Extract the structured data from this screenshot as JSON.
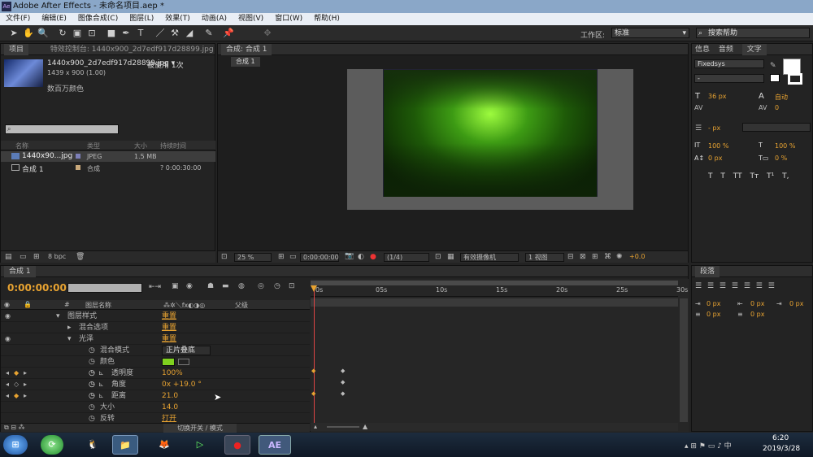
{
  "window": {
    "title": "Adobe After Effects - 未命名项目.aep *",
    "logo": "Ae"
  },
  "menu": [
    "文件(F)",
    "编辑(E)",
    "图像合成(C)",
    "图层(L)",
    "效果(T)",
    "动画(A)",
    "视图(V)",
    "窗口(W)",
    "帮助(H)"
  ],
  "toolbar": {
    "workspace_label": "工作区:",
    "workspace_value": "标准",
    "search_placeholder": "搜索帮助"
  },
  "project": {
    "tab_project": "项目",
    "tab_effects": "特效控制台: 1440x900_2d7edf917d28899.jpg",
    "file_name": "1440x900_2d7edf917d28899.jpg ▾",
    "used": "被使用 1次",
    "dims": "1439 x 900 (1.00)",
    "color": "数百万颜色",
    "columns": [
      "名称",
      "类型",
      "大小",
      "持续时间"
    ],
    "items": [
      {
        "name": "1440x90...jpg",
        "type": "JPEG",
        "size": "1.5 MB",
        "duration": ""
      },
      {
        "name": "合成 1",
        "type": "合成",
        "size": "",
        "duration": "? 0:00:30:00"
      }
    ],
    "bpc": "8 bpc"
  },
  "comp": {
    "tab": "合成: 合成 1",
    "subtab": "合成 1",
    "zoom": "25 %",
    "time": "0:00:00:00",
    "res": "(1/4)",
    "camera": "有效摄像机",
    "view": "1 视图",
    "exposure": "+0.0"
  },
  "text_panel": {
    "tabs": [
      "信息",
      "音频",
      "文字"
    ],
    "font": "Fixedsys",
    "style": "-",
    "size": "36 px",
    "leading": "自动",
    "kerning": "",
    "tracking": "0",
    "stroke": "- px",
    "vscale": "100 %",
    "hscale": "100 %",
    "baseline": "0 px",
    "tsume": "0 %",
    "styles": [
      "T",
      "T",
      "TT",
      "Tт",
      "T¹",
      "T,"
    ]
  },
  "paragraph": {
    "tab": "段落",
    "vals": [
      "0 px",
      "0 px",
      "0 px",
      "0 px",
      "0 px"
    ]
  },
  "timeline": {
    "tab": "合成 1",
    "time": "0:00:00:00",
    "col_name": "图层名称",
    "col_parent": "父级",
    "ruler": [
      "0s",
      "05s",
      "10s",
      "15s",
      "20s",
      "25s",
      "30s"
    ],
    "layers": [
      {
        "name": "图层样式",
        "value": "重置"
      },
      {
        "name": "混合选项",
        "value": "重置"
      },
      {
        "name": "光泽",
        "value": "重置"
      },
      {
        "name": "混合模式",
        "value": "正片叠底"
      },
      {
        "name": "颜色",
        "value": ""
      },
      {
        "name": "透明度",
        "value": "100%"
      },
      {
        "name": "角度",
        "value": "0x +19.0 °"
      },
      {
        "name": "距离",
        "value": "21.0"
      },
      {
        "name": "大小",
        "value": "14.0"
      },
      {
        "name": "反转",
        "value": "打开"
      }
    ],
    "footer": "切换开关 / 模式"
  },
  "taskbar": {
    "time": "6:20",
    "date": "2019/3/28",
    "ae_label": "AE"
  },
  "colors": {
    "accent": "#e8a331",
    "gloss": "#7fd01f"
  }
}
